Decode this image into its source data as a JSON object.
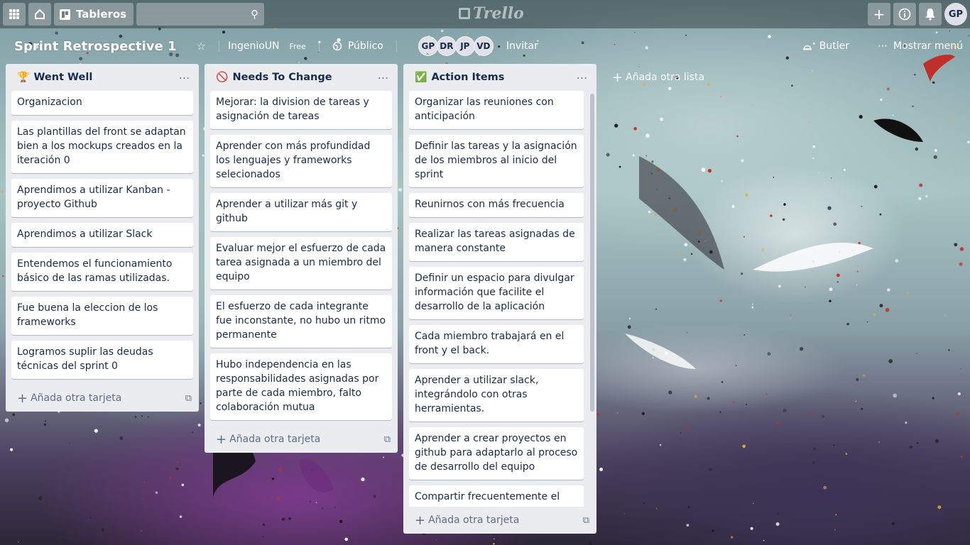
{
  "header": {
    "apps_icon": "grid-icon",
    "home_icon": "home-icon",
    "boards_label": "Tableros",
    "search_placeholder": "",
    "logo_text": "Trello",
    "right_icons": [
      "plus-icon",
      "info-icon",
      "bell-icon"
    ],
    "user_initials": "GP"
  },
  "board": {
    "title": "Sprint Retrospective 1",
    "team": "IngenioUN",
    "plan": "Free",
    "visibility": "Público",
    "members": [
      "GP",
      "DR",
      "JP",
      "VD"
    ],
    "invite_label": "Invitar",
    "butler_label": "Butler",
    "menu_label": "Mostrar menú"
  },
  "lists": [
    {
      "emoji": "🏆",
      "title": "Went Well",
      "cards": [
        "Organizacion",
        "Las plantillas del front se adaptan bien a los mockups creados en la iteración 0",
        "Aprendimos a utilizar Kanban - proyecto Github",
        "Aprendimos a utilizar Slack",
        "Entendemos el funcionamiento básico de las ramas utilizadas.",
        "Fue buena la eleccion de los frameworks",
        "Logramos suplir las deudas técnicas del sprint 0"
      ],
      "add_card_label": "Añada otra tarjeta"
    },
    {
      "emoji": "🚫",
      "title": "Needs To Change",
      "cards": [
        "Mejorar: la division de tareas y asignación de tareas",
        "Aprender con más profundidad los lenguajes y frameworks selecionados",
        "Aprender a utilizar más git y github",
        "Evaluar mejor el esfuerzo de cada tarea asignada a un miembro del equipo",
        "El esfuerzo de cada integrante fue inconstante, no hubo un ritmo permanente",
        "Hubo independencia en las responsabilidades asignadas por parte de cada miembro, falto colaboración mutua"
      ],
      "add_card_label": "Añada otra tarjeta"
    },
    {
      "emoji": "✅",
      "title": "Action Items",
      "cards": [
        "Organizar las reuniones con anticipación",
        "Definir las tareas y la asignación de los miembros al inicio del sprint",
        "Reunirnos con más frecuencia",
        "Realizar las tareas asignadas de manera constante",
        "Definir un espacio para divulgar información que facilite el desarrollo de la aplicación",
        "Cada miembro trabajará en el front y el back.",
        "Aprender a utilizar slack, integrándolo con otras herramientas.",
        "Aprender a crear proyectos en github para adaptarlo al proceso de desarrollo del equipo",
        "Compartir frecuentemente el"
      ],
      "add_card_label": "Añada otra tarjeta"
    }
  ],
  "add_list_label": "Añada otra lista"
}
